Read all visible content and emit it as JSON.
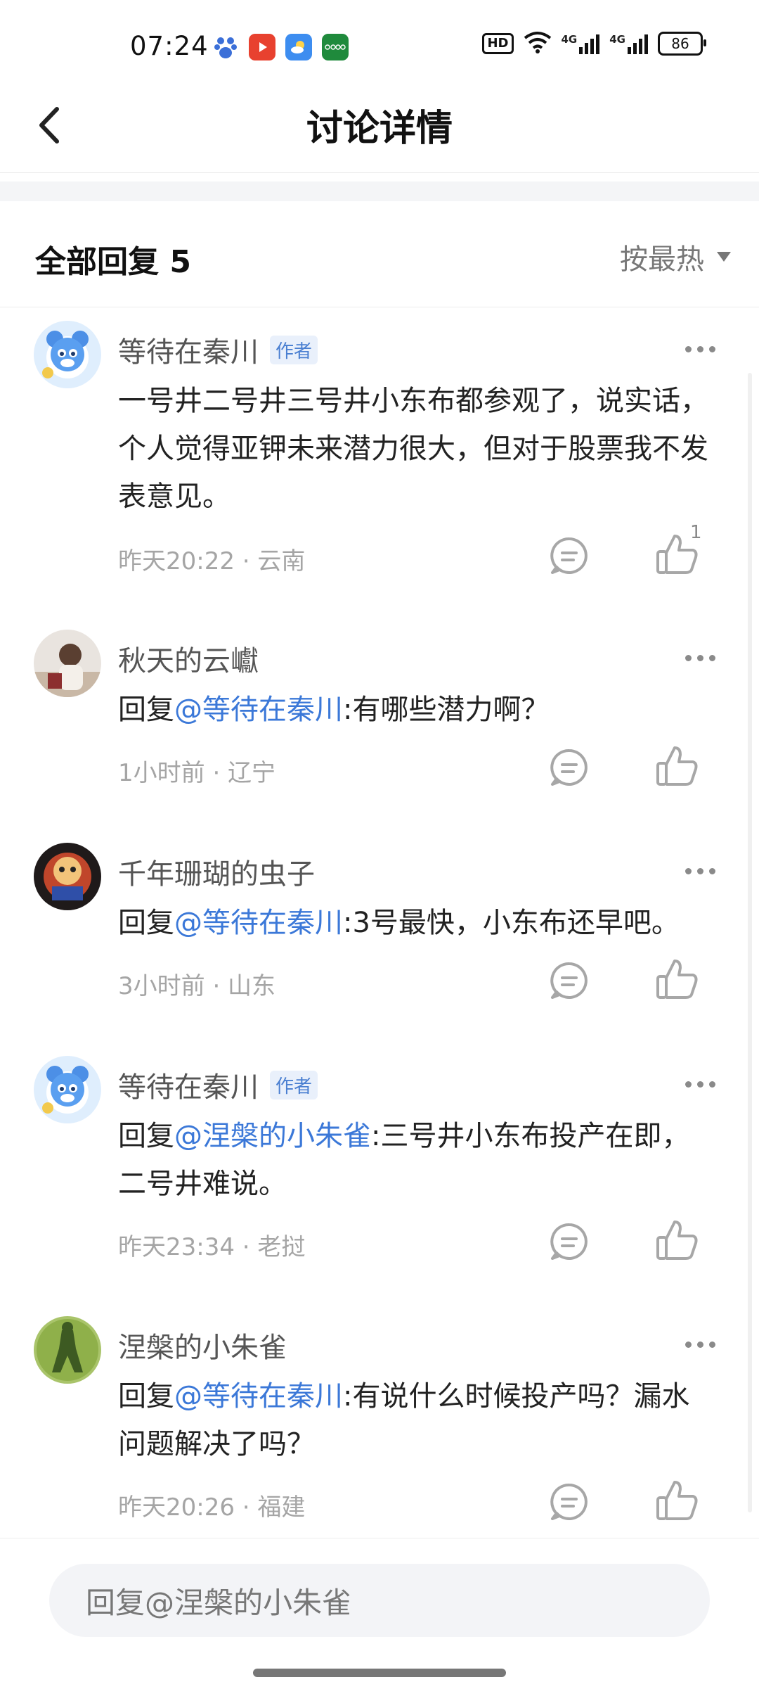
{
  "status_bar": {
    "time": "07:24",
    "battery": "86",
    "network_1": "4G",
    "network_2": "4G",
    "hd": "HD"
  },
  "nav": {
    "title": "讨论详情"
  },
  "replies_header": {
    "title": "全部回复 5",
    "sort_label": "按最热"
  },
  "comments": [
    {
      "name": "等待在秦川",
      "author_tag": "作者",
      "body": "一号井二号井三号井小东布都参观了，说实话，个人觉得亚钾未来潜力很大，但对于股票我不发表意见。",
      "meta": "昨天20:22 · 云南",
      "like_count": "1"
    },
    {
      "name": "秋天的云巘",
      "reply_prefix": "回复",
      "mention": "@等待在秦川",
      "body": ":有哪些潜力啊？",
      "meta": "1小时前 · 辽宁"
    },
    {
      "name": "千年珊瑚的虫子",
      "reply_prefix": "回复",
      "mention": "@等待在秦川",
      "body": ":3号最快，小东布还早吧。",
      "meta": "3小时前 · 山东"
    },
    {
      "name": "等待在秦川",
      "author_tag": "作者",
      "reply_prefix": "回复",
      "mention": "@涅槃的小朱雀",
      "body": ":三号井小东布投产在即，二号井难说。",
      "meta": "昨天23:34 · 老挝"
    },
    {
      "name": "涅槃的小朱雀",
      "reply_prefix": "回复",
      "mention": "@等待在秦川",
      "body": ":有说什么时候投产吗？漏水问题解决了吗？",
      "meta": "昨天20:26 · 福建"
    }
  ],
  "input": {
    "placeholder": "回复@涅槃的小朱雀"
  },
  "colors": {
    "accent": "#3b78d8",
    "author_tag_bg": "#e9f0fb"
  },
  "icons": [
    "back-arrow-icon",
    "more-icon",
    "reply-icon",
    "like-icon",
    "sort-caret-icon"
  ]
}
